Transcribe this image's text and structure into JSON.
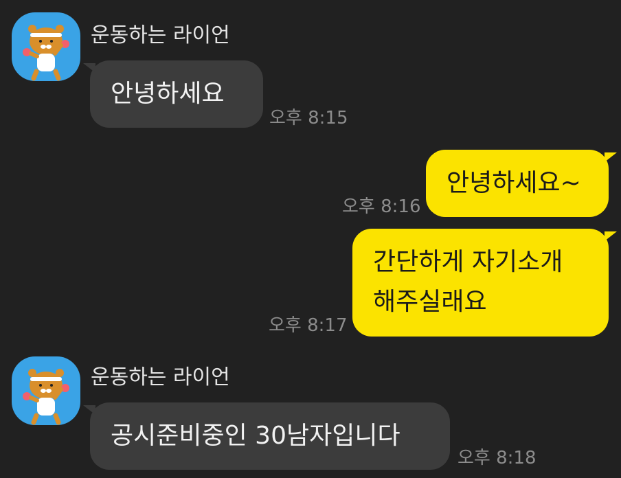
{
  "messages": [
    {
      "sender": "운동하는 라이언",
      "text": "안녕하세요",
      "time": "오후 8:15"
    },
    {
      "text": "안녕하세요~",
      "time": "오후 8:16"
    },
    {
      "text_line1": "간단하게 자기소개",
      "text_line2": "해주실래요",
      "time": "오후 8:17"
    },
    {
      "sender": "운동하는 라이언",
      "text": "공시준비중인 30남자입니다",
      "time": "오후 8:18"
    }
  ],
  "colors": {
    "background": "#212121",
    "incoming_bubble": "#3c3c3c",
    "outgoing_bubble": "#fbe300",
    "avatar_bg": "#3aa3e6"
  },
  "icons": {
    "avatar": "ryan-exercising-avatar-icon"
  }
}
